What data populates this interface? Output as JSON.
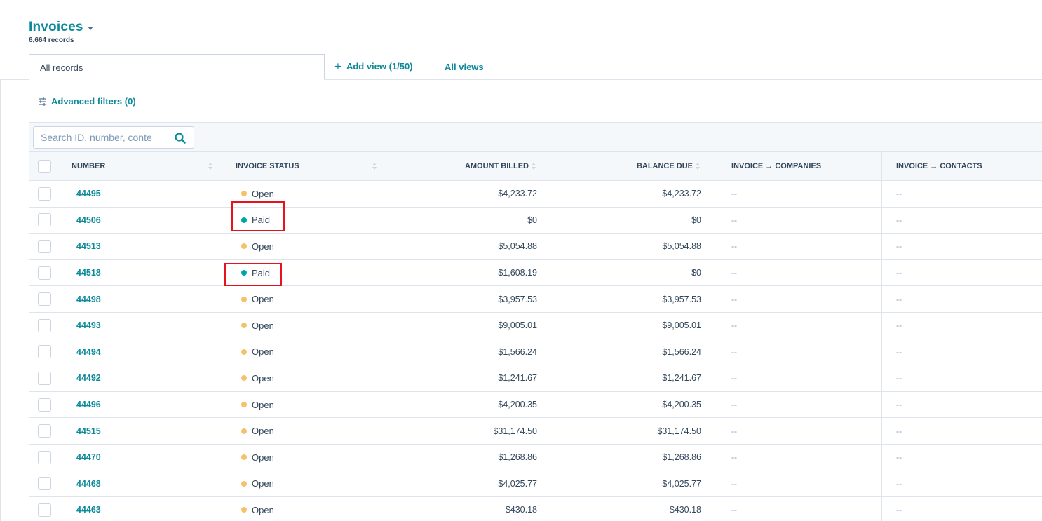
{
  "header": {
    "title": "Invoices",
    "record_count": "6,664 records"
  },
  "tabs": {
    "active_label": "All records",
    "add_view_label": "Add view (1/50)",
    "all_views_label": "All views"
  },
  "filters": {
    "advanced_label": "Advanced filters (0)"
  },
  "search": {
    "placeholder": "Search ID, number, conte"
  },
  "columns": {
    "number": "Number",
    "status": "Invoice status",
    "billed": "Amount billed",
    "balance": "Balance due",
    "companies": "Invoice → Companies",
    "contacts": "Invoice → Contacts"
  },
  "colors": {
    "accent": "#0b8a9a",
    "open": "#f5c26b",
    "paid": "#00a4a6",
    "highlight": "#e8121e"
  },
  "rows": [
    {
      "number": "44495",
      "status": "Open",
      "billed": "$4,233.72",
      "balance": "$4,233.72",
      "companies": "--",
      "contacts": "--"
    },
    {
      "number": "44506",
      "status": "Paid",
      "billed": "$0",
      "balance": "$0",
      "companies": "--",
      "contacts": "--"
    },
    {
      "number": "44513",
      "status": "Open",
      "billed": "$5,054.88",
      "balance": "$5,054.88",
      "companies": "--",
      "contacts": "--"
    },
    {
      "number": "44518",
      "status": "Paid",
      "billed": "$1,608.19",
      "balance": "$0",
      "companies": "--",
      "contacts": "--"
    },
    {
      "number": "44498",
      "status": "Open",
      "billed": "$3,957.53",
      "balance": "$3,957.53",
      "companies": "--",
      "contacts": "--"
    },
    {
      "number": "44493",
      "status": "Open",
      "billed": "$9,005.01",
      "balance": "$9,005.01",
      "companies": "--",
      "contacts": "--"
    },
    {
      "number": "44494",
      "status": "Open",
      "billed": "$1,566.24",
      "balance": "$1,566.24",
      "companies": "--",
      "contacts": "--"
    },
    {
      "number": "44492",
      "status": "Open",
      "billed": "$1,241.67",
      "balance": "$1,241.67",
      "companies": "--",
      "contacts": "--"
    },
    {
      "number": "44496",
      "status": "Open",
      "billed": "$4,200.35",
      "balance": "$4,200.35",
      "companies": "--",
      "contacts": "--"
    },
    {
      "number": "44515",
      "status": "Open",
      "billed": "$31,174.50",
      "balance": "$31,174.50",
      "companies": "--",
      "contacts": "--"
    },
    {
      "number": "44470",
      "status": "Open",
      "billed": "$1,268.86",
      "balance": "$1,268.86",
      "companies": "--",
      "contacts": "--"
    },
    {
      "number": "44468",
      "status": "Open",
      "billed": "$4,025.77",
      "balance": "$4,025.77",
      "companies": "--",
      "contacts": "--"
    },
    {
      "number": "44463",
      "status": "Open",
      "billed": "$430.18",
      "balance": "$430.18",
      "companies": "--",
      "contacts": "--"
    }
  ]
}
